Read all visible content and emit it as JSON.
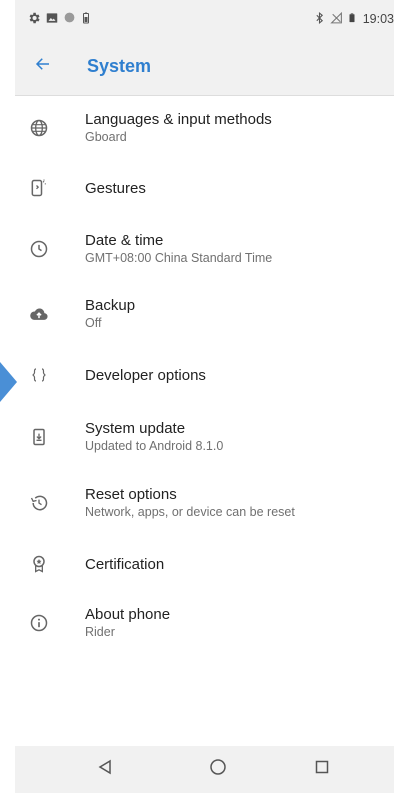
{
  "status_bar": {
    "time": "19:03",
    "left_icons": [
      "settings-icon",
      "image-icon",
      "circle-icon",
      "battery-icon"
    ],
    "right_icons": [
      "bluetooth-icon",
      "no-sim-icon",
      "battery-icon"
    ]
  },
  "app_bar": {
    "title": "System",
    "back_icon": "arrow-left-icon",
    "accent_color": "#2f7fcf"
  },
  "settings": [
    {
      "icon": "globe-icon",
      "title": "Languages & input methods",
      "subtitle": "Gboard"
    },
    {
      "icon": "gestures-icon",
      "title": "Gestures",
      "subtitle": ""
    },
    {
      "icon": "clock-icon",
      "title": "Date & time",
      "subtitle": "GMT+08:00 China Standard Time"
    },
    {
      "icon": "cloud-upload-icon",
      "title": "Backup",
      "subtitle": "Off"
    },
    {
      "icon": "code-braces-icon",
      "title": "Developer options",
      "subtitle": ""
    },
    {
      "icon": "system-update-icon",
      "title": "System update",
      "subtitle": "Updated to Android 8.1.0"
    },
    {
      "icon": "restore-icon",
      "title": "Reset options",
      "subtitle": "Network, apps, or device can be reset"
    },
    {
      "icon": "certificate-icon",
      "title": "Certification",
      "subtitle": ""
    },
    {
      "icon": "info-icon",
      "title": "About phone",
      "subtitle": "Rider"
    }
  ],
  "nav_bar": {
    "buttons": [
      "back-triangle-icon",
      "home-circle-icon",
      "recents-square-icon"
    ]
  }
}
